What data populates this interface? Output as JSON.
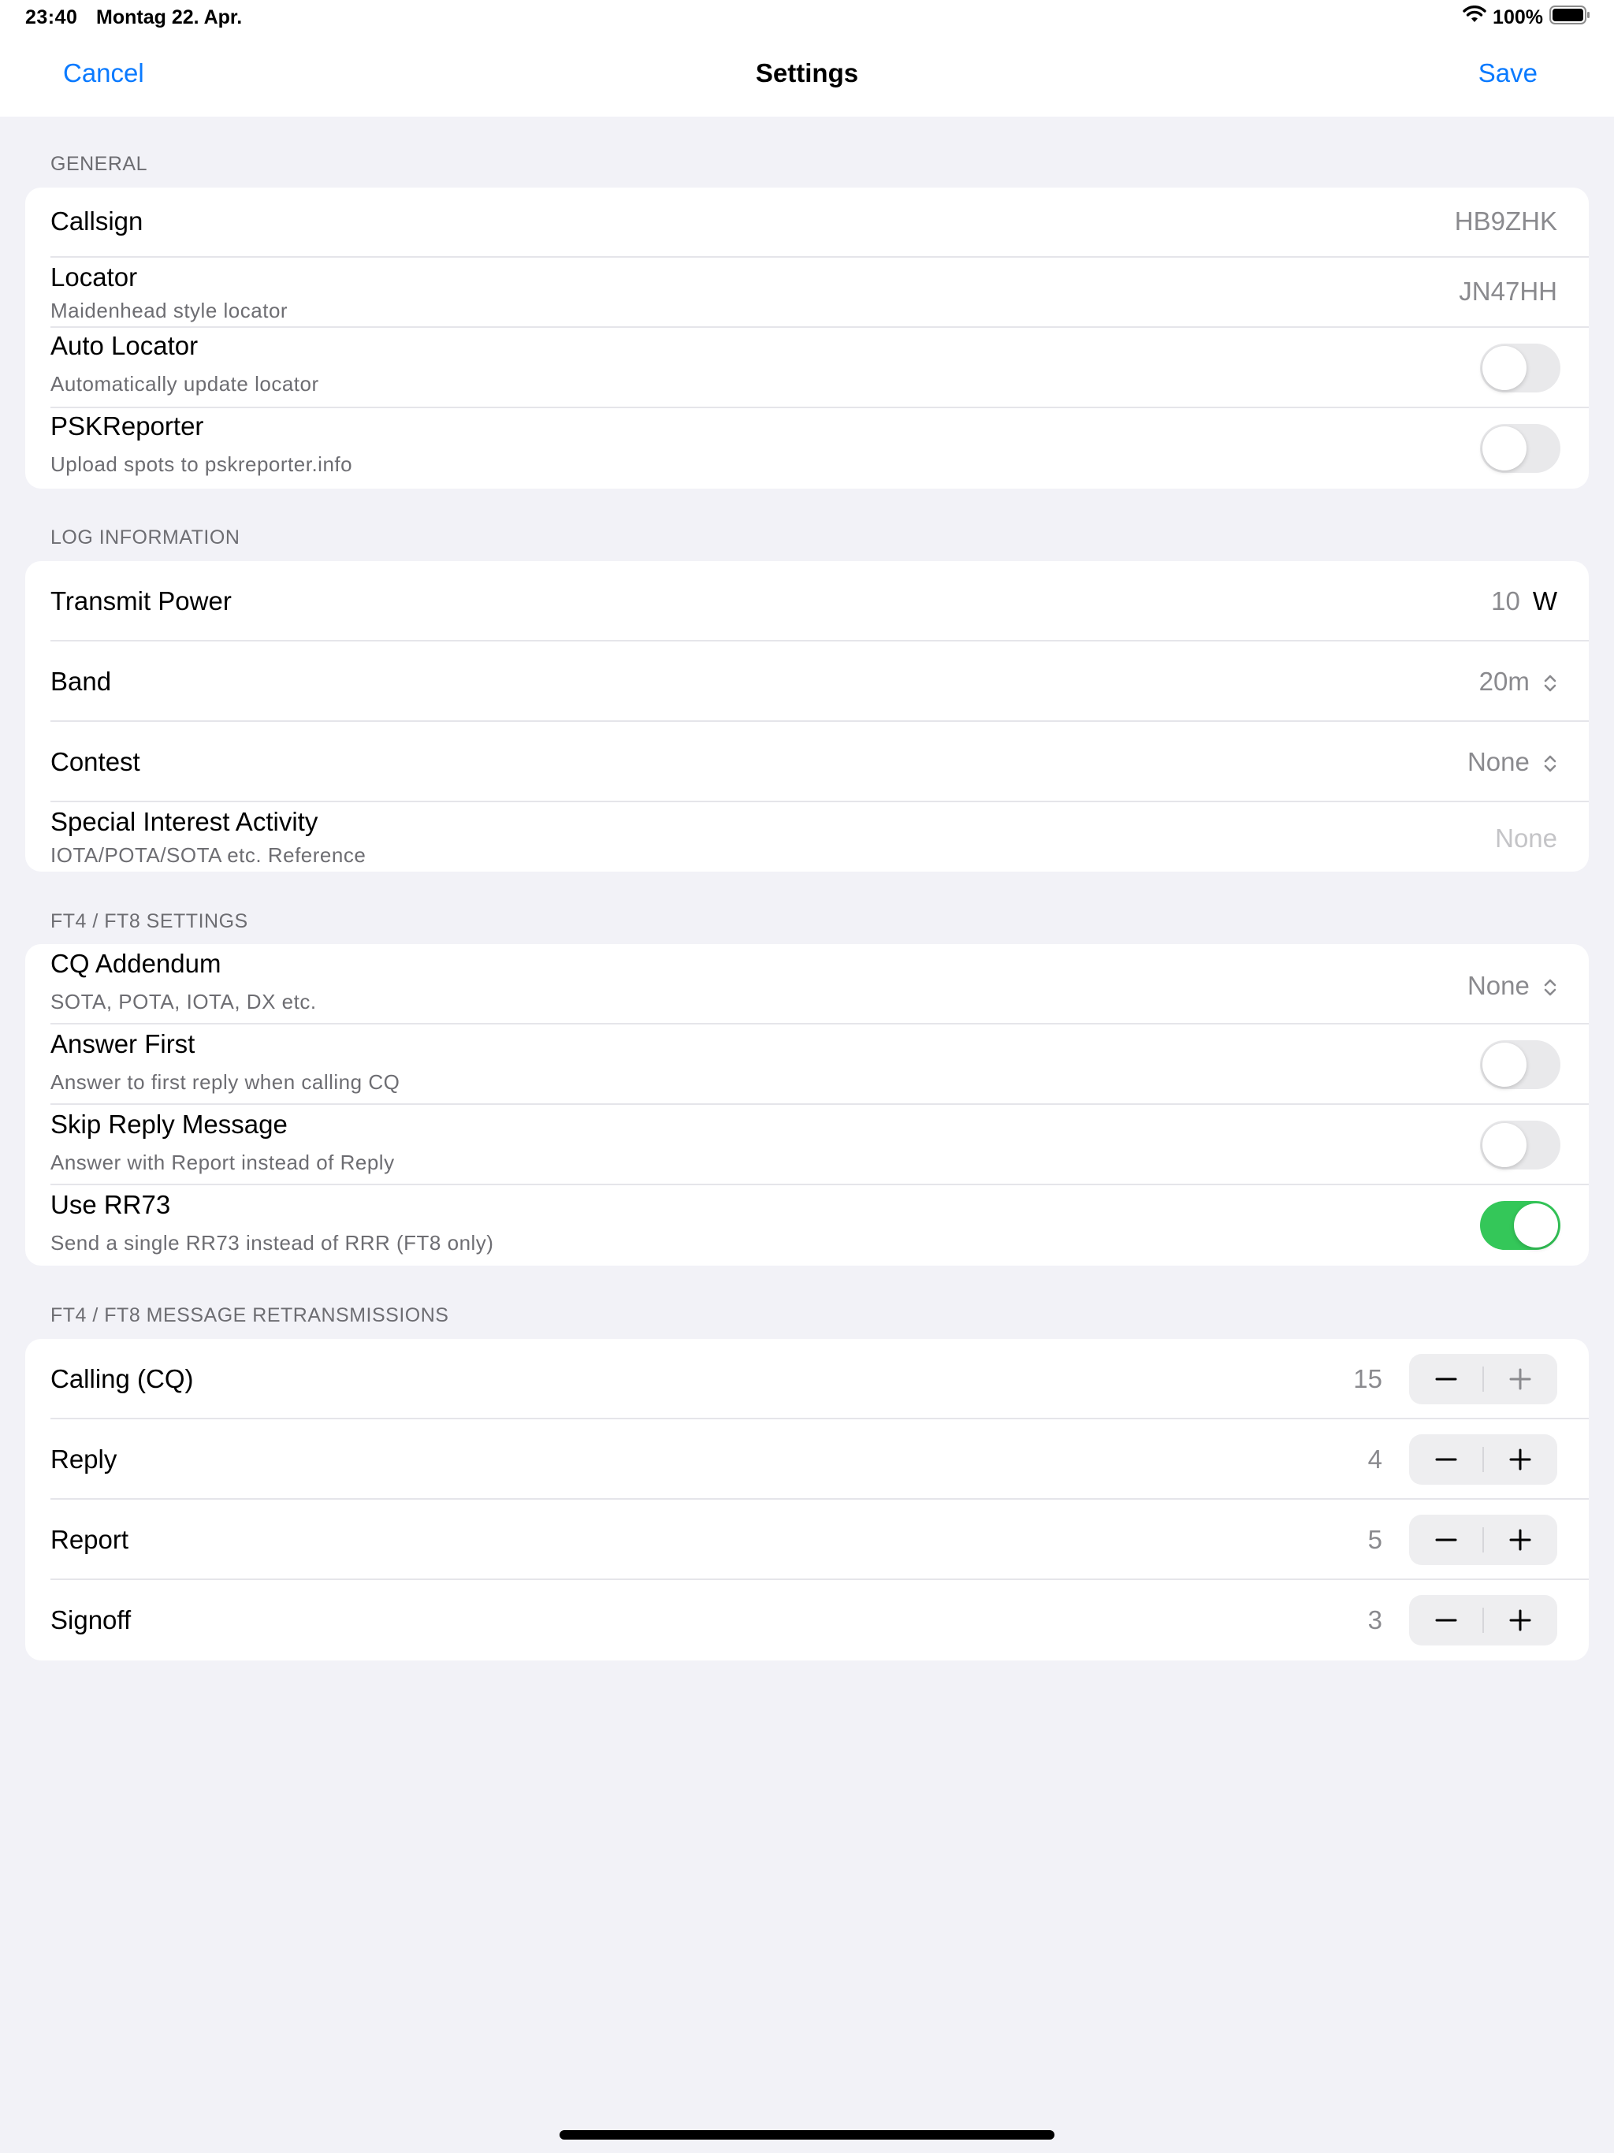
{
  "status_bar": {
    "time": "23:40",
    "date": "Montag 22. Apr.",
    "battery": "100%"
  },
  "nav": {
    "cancel_label": "Cancel",
    "title": "Settings",
    "save_label": "Save"
  },
  "general": {
    "header": "GENERAL",
    "callsign": {
      "title": "Callsign",
      "value": "HB9ZHK"
    },
    "locator": {
      "title": "Locator",
      "subtitle": "Maidenhead style locator",
      "value": "JN47HH"
    },
    "auto_locator": {
      "title": "Auto Locator",
      "subtitle": "Automatically update locator",
      "on": false
    },
    "pskreporter": {
      "title": "PSKReporter",
      "subtitle": "Upload spots to pskreporter.info",
      "on": false
    }
  },
  "log_information": {
    "header": "LOG INFORMATION",
    "transmit_power": {
      "title": "Transmit Power",
      "value": "10",
      "unit": "W"
    },
    "band": {
      "title": "Band",
      "value": "20m"
    },
    "contest": {
      "title": "Contest",
      "value": "None"
    },
    "sia": {
      "title": "Special Interest Activity",
      "subtitle": "IOTA/POTA/SOTA etc. Reference",
      "placeholder": "None"
    }
  },
  "ft_settings": {
    "header": "FT4 / FT8 SETTINGS",
    "cq_addendum": {
      "title": "CQ Addendum",
      "subtitle": "SOTA, POTA, IOTA, DX etc.",
      "value": "None"
    },
    "answer_first": {
      "title": "Answer First",
      "subtitle": "Answer to first reply when calling CQ",
      "on": false
    },
    "skip_reply": {
      "title": "Skip Reply Message",
      "subtitle": "Answer with Report instead of Reply",
      "on": false
    },
    "use_rr73": {
      "title": "Use RR73",
      "subtitle": "Send a single RR73 instead of RRR (FT8 only)",
      "on": true
    }
  },
  "retransmissions": {
    "header": "FT4 / FT8 MESSAGE RETRANSMISSIONS",
    "calling": {
      "title": "Calling (CQ)",
      "value": "15"
    },
    "reply": {
      "title": "Reply",
      "value": "4"
    },
    "report": {
      "title": "Report",
      "value": "5"
    },
    "signoff": {
      "title": "Signoff",
      "value": "3"
    }
  },
  "colors": {
    "accent": "#0a7aff",
    "toggle_on": "#34c759",
    "background": "#f2f2f7"
  }
}
